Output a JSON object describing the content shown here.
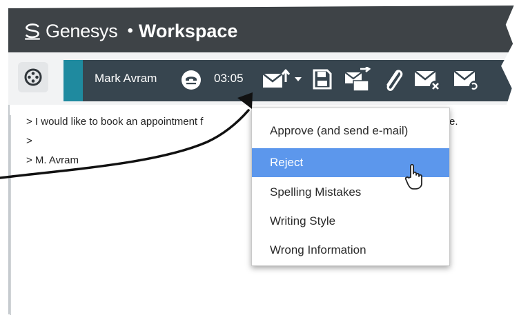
{
  "app": {
    "brand": "Genesys",
    "separator": "•",
    "product": "Workspace"
  },
  "interaction": {
    "contact_name": "Mark Avram",
    "timer": "03:05"
  },
  "email_body": {
    "lines": [
      "> I would like to book an appointment f",
      ">",
      "> M. Avram"
    ],
    "trailing_fragment": "e."
  },
  "reject_menu": {
    "items": [
      {
        "label": "Approve (and send e-mail)",
        "highlighted": false
      },
      {
        "label": "Reject",
        "highlighted": true
      },
      {
        "label": "Spelling Mistakes",
        "highlighted": false
      },
      {
        "label": "Writing Style",
        "highlighted": false
      },
      {
        "label": "Wrong Information",
        "highlighted": false
      }
    ]
  },
  "colors": {
    "title_bar": "#3e4347",
    "interaction_bar": "#37454f",
    "accent": "#1f8a9f",
    "menu_highlight": "#5c97ec"
  },
  "icons": [
    "genesys-logo-icon",
    "main-menu-icon",
    "voice-channel-icon",
    "send-review-icon",
    "dropdown-caret-icon",
    "save-icon",
    "transfer-icon",
    "attach-icon",
    "delete-email-icon",
    "more-email-icon",
    "hand-cursor-icon"
  ]
}
